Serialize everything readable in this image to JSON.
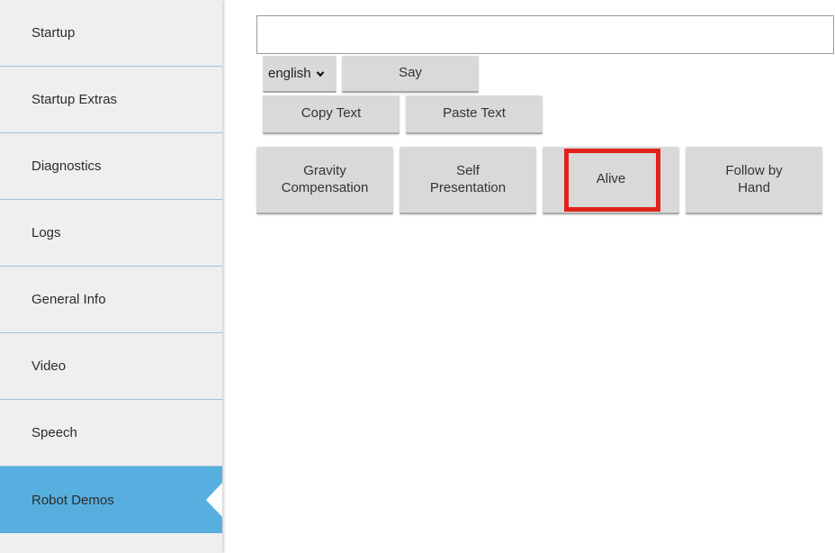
{
  "sidebar": {
    "items": [
      {
        "label": "Startup"
      },
      {
        "label": "Startup Extras"
      },
      {
        "label": "Diagnostics"
      },
      {
        "label": "Logs"
      },
      {
        "label": "General Info"
      },
      {
        "label": "Video"
      },
      {
        "label": "Speech"
      },
      {
        "label": "Robot Demos"
      }
    ],
    "active_item": "Robot Demos"
  },
  "speech": {
    "input_value": "",
    "language": "english",
    "say_label": "Say",
    "copy_label": "Copy Text",
    "paste_label": "Paste Text"
  },
  "demos": {
    "buttons": [
      {
        "line1": "Gravity",
        "line2": "Compensation"
      },
      {
        "line1": "Self",
        "line2": "Presentation"
      },
      {
        "line1": "Alive",
        "line2": ""
      },
      {
        "line1": "Follow by",
        "line2": "Hand"
      }
    ]
  },
  "colors": {
    "active_tab": "#57afe0",
    "highlight": "#e0231b",
    "button_bg": "#d9d9d9"
  }
}
